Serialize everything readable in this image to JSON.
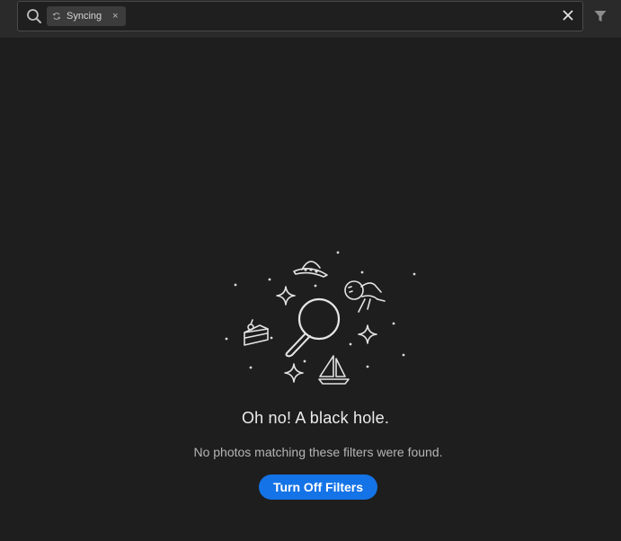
{
  "search": {
    "filter_chip_label": "Syncing",
    "filter_chip_icon": "sync-icon",
    "chip_remove_label": "×",
    "search_icon": "search-icon",
    "clear_icon": "close-icon"
  },
  "toolbar": {
    "filter_icon": "filter-funnel-icon"
  },
  "empty_state": {
    "title": "Oh no! A black hole.",
    "message": "No photos matching these filters were found.",
    "button_label": "Turn Off Filters",
    "illustration_icon": "black-hole-space-illustration"
  },
  "colors": {
    "background": "#1e1e1e",
    "topbar": "#2a2a2a",
    "accent_button": "#1473e6",
    "text_primary": "#ececec",
    "text_secondary": "#b5b5b5"
  }
}
